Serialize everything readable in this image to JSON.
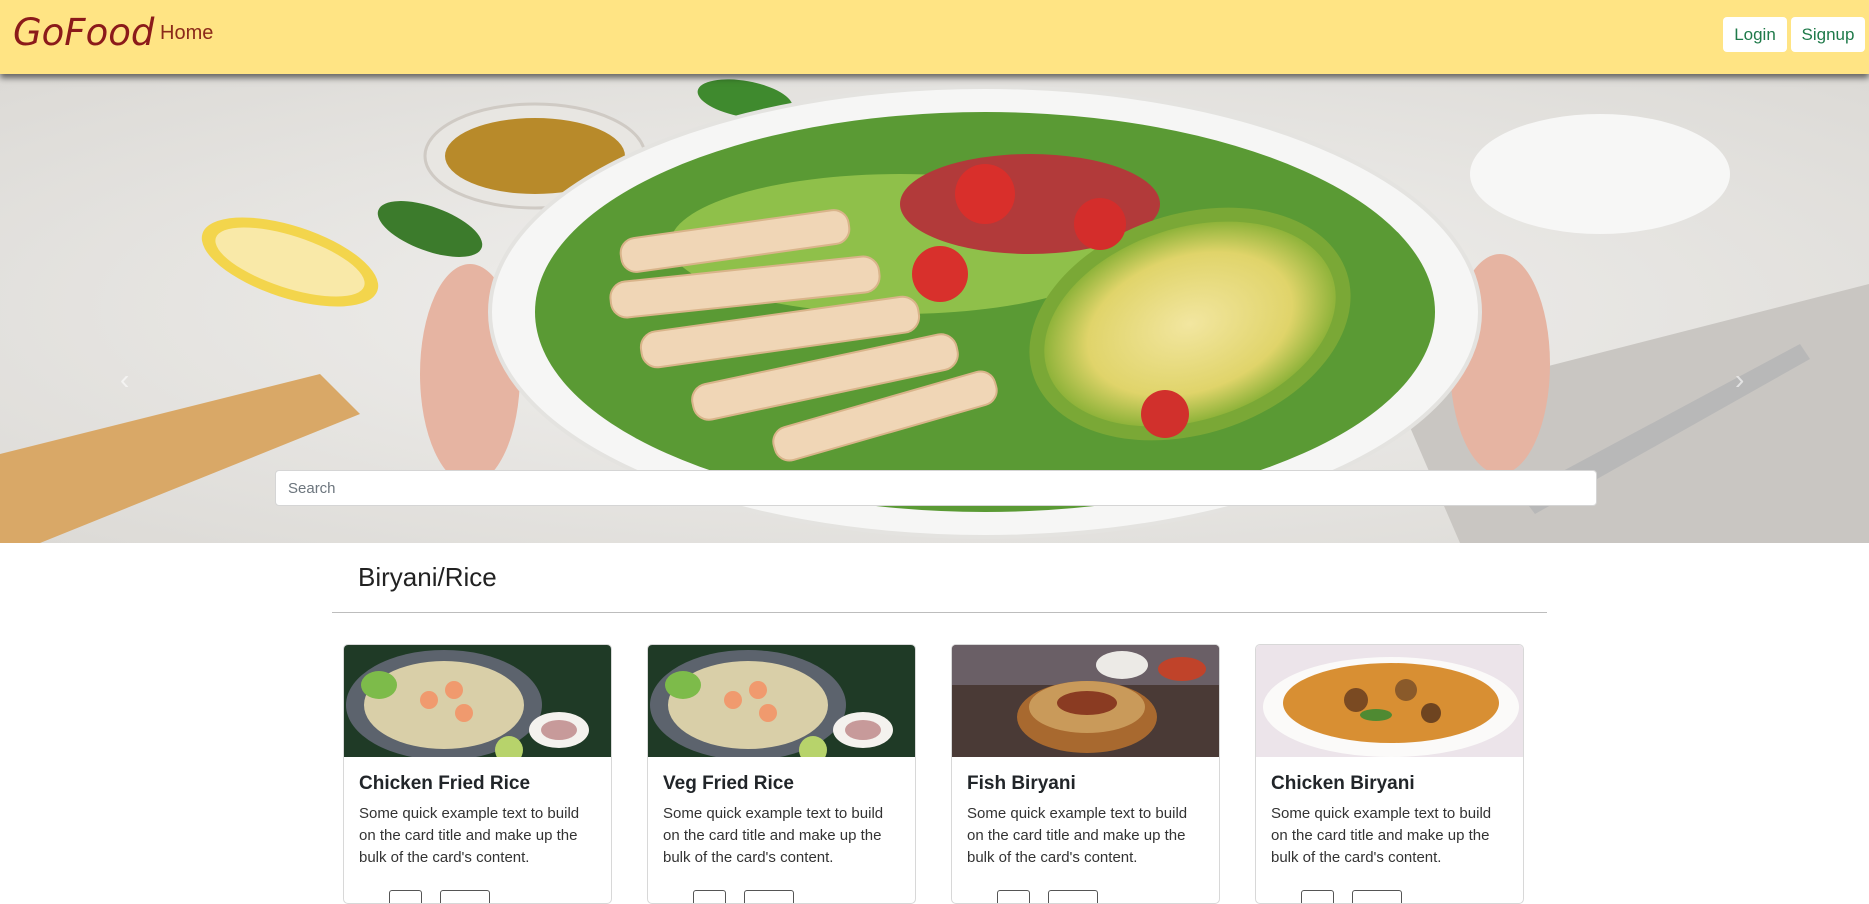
{
  "navbar": {
    "brand": "GoFood",
    "home_label": "Home",
    "login_label": "Login",
    "signup_label": "Signup"
  },
  "hero": {
    "search_placeholder": "Search"
  },
  "category": {
    "title": "Biryani/Rice"
  },
  "cards": [
    {
      "title": "Chicken Fried Rice",
      "text": "Some quick example text to build on the card title and make up the bulk of the card's content."
    },
    {
      "title": "Veg Fried Rice",
      "text": "Some quick example text to build on the card title and make up the bulk of the card's content."
    },
    {
      "title": "Fish Biryani",
      "text": "Some quick example text to build on the card title and make up the bulk of the card's content."
    },
    {
      "title": "Chicken Biryani",
      "text": "Some quick example text to build on the card title and make up the bulk of the card's content."
    }
  ],
  "colors": {
    "navbar_bg": "#ffe484",
    "brand": "#8b1a1a",
    "button_text": "#1f7a4a"
  }
}
